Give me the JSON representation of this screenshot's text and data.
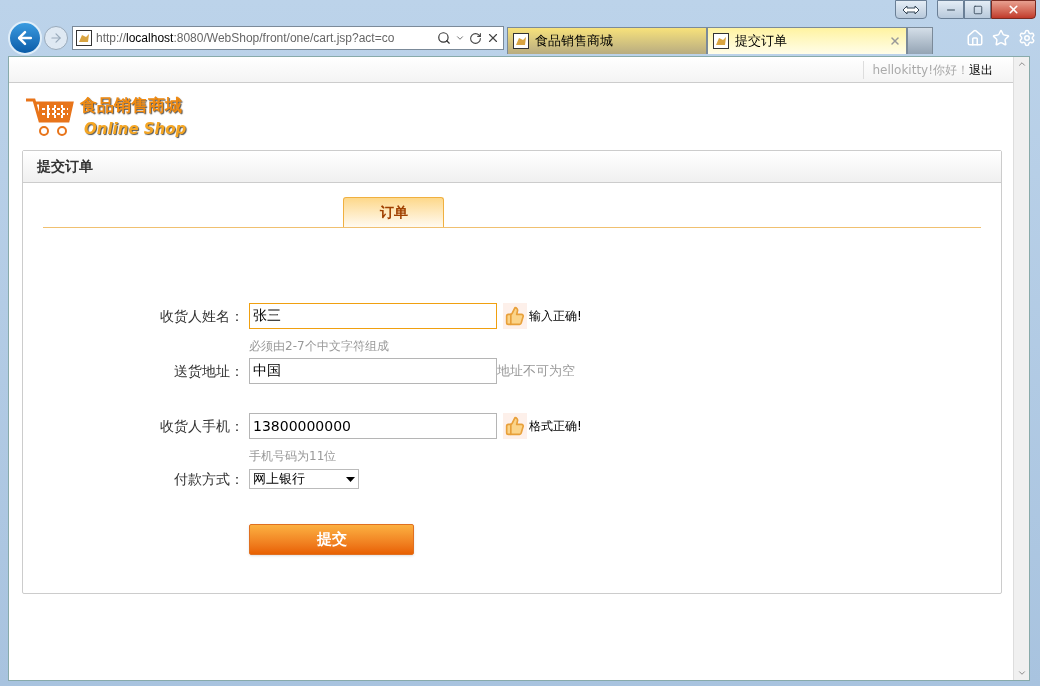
{
  "browser": {
    "address": "http://**localhost**:8080/WebShop/front/one/cart.jsp?act=co",
    "tabs": [
      {
        "label": "食品销售商城",
        "selected": false
      },
      {
        "label": "提交订单",
        "selected": true
      }
    ]
  },
  "header": {
    "greeting": "hellokitty!你好！",
    "logout": "退出"
  },
  "logo": {
    "title": "食品销售商城",
    "subtitle": "Online Shop"
  },
  "panel": {
    "title": "提交订单",
    "tabs": [
      {
        "label": "订单",
        "selected": true
      }
    ]
  },
  "form": {
    "fields": [
      {
        "kind": "text",
        "label": "收货人姓名：",
        "value": "张三",
        "focused": true,
        "valid": true,
        "message": "输入正确!",
        "hint": "必须由2-7个中文字符组成"
      },
      {
        "kind": "text",
        "label": "送货地址：",
        "value": "中国",
        "focused": false,
        "valid": false,
        "message": "地址不可为空"
      },
      {
        "kind": "text",
        "label": "收货人手机：",
        "value": "13800000000",
        "focused": false,
        "valid": true,
        "message": "格式正确!",
        "hint": "手机号码为11位"
      },
      {
        "kind": "select",
        "label": "付款方式：",
        "value": "网上银行"
      }
    ],
    "submit": "提交"
  }
}
